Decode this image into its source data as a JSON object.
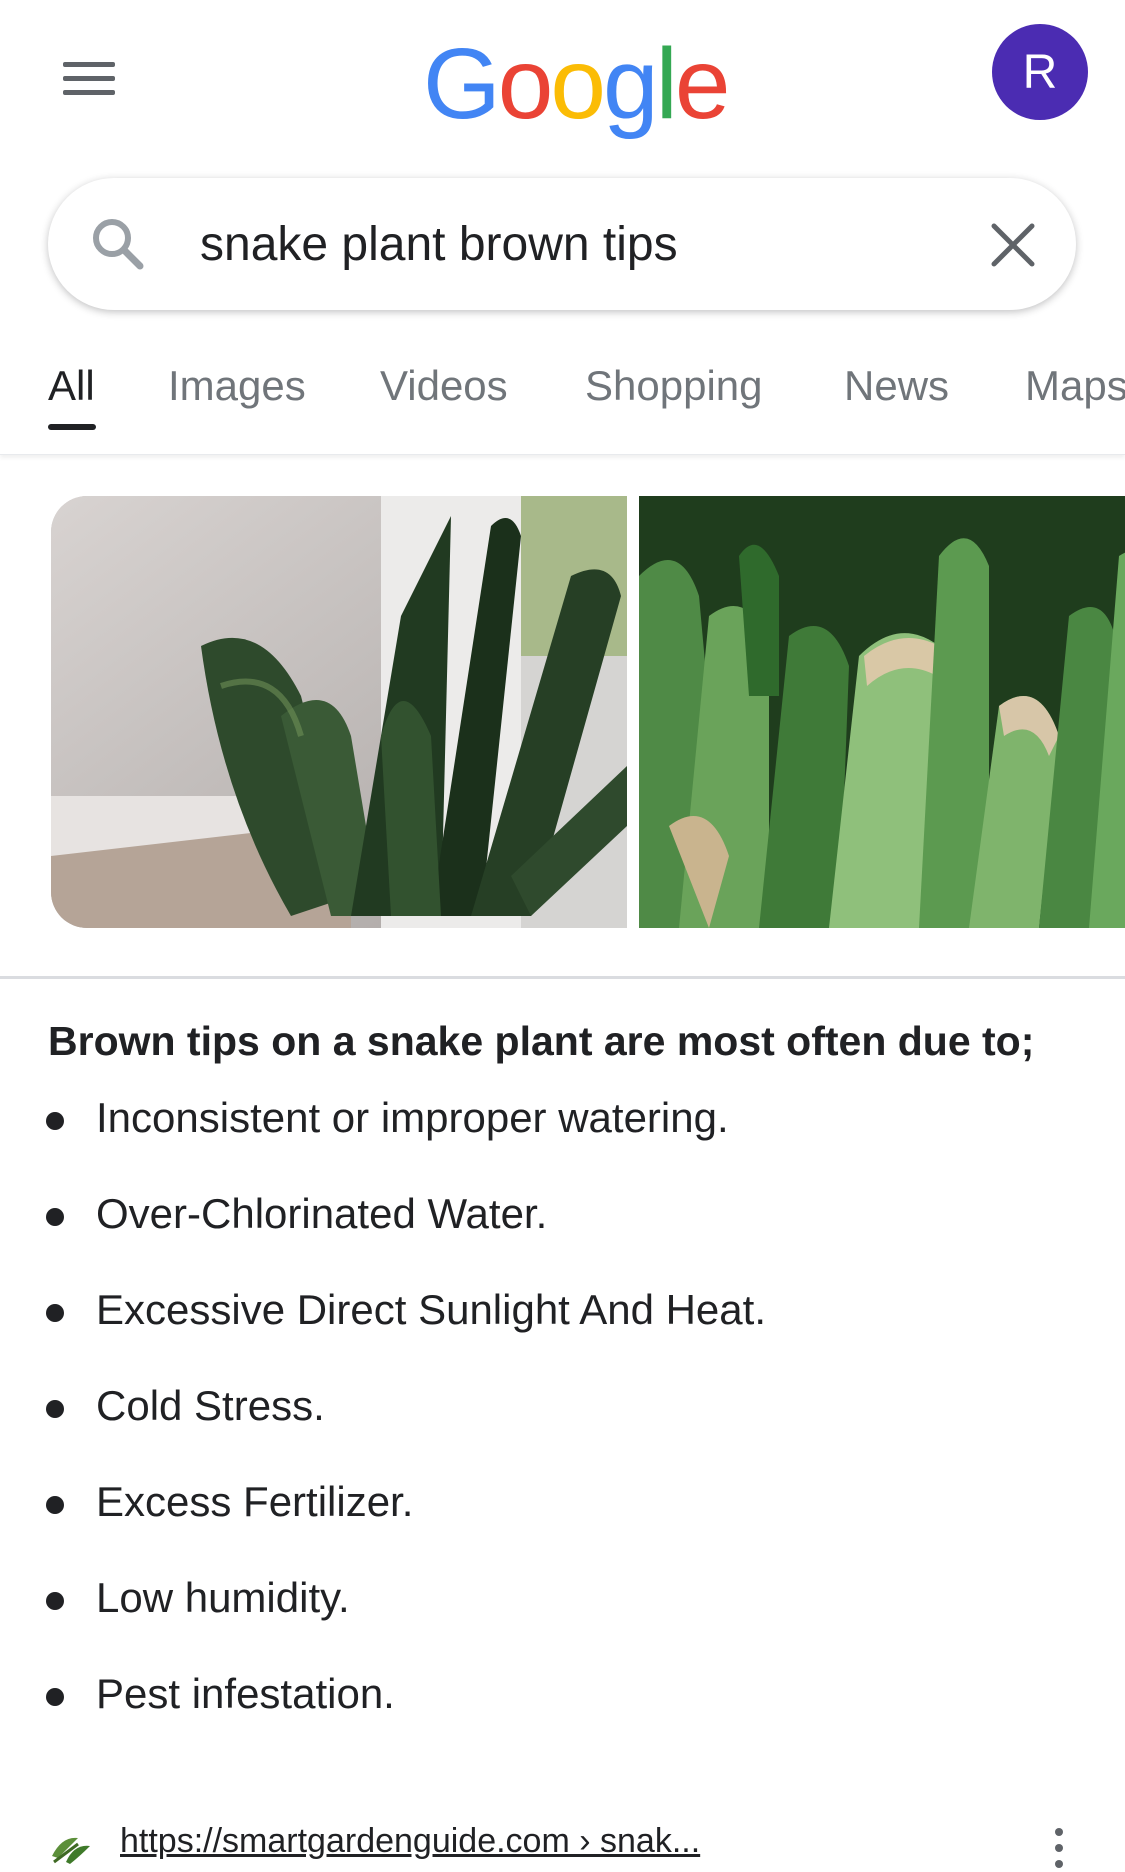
{
  "header": {
    "logo_letters": [
      {
        "char": "G",
        "color": "#4285F4"
      },
      {
        "char": "o",
        "color": "#EA4335"
      },
      {
        "char": "o",
        "color": "#FBBC05"
      },
      {
        "char": "g",
        "color": "#4285F4"
      },
      {
        "char": "l",
        "color": "#34A853"
      },
      {
        "char": "e",
        "color": "#EA4335"
      }
    ],
    "avatar_initial": "R",
    "avatar_color": "#4B2CB2",
    "menu_icon": "hamburger-menu-icon"
  },
  "search": {
    "query": "snake plant brown tips",
    "search_icon": "search-icon",
    "clear_icon": "close-icon"
  },
  "tabs": [
    {
      "label": "All",
      "active": true
    },
    {
      "label": "Images",
      "active": false
    },
    {
      "label": "Videos",
      "active": false
    },
    {
      "label": "Shopping",
      "active": false
    },
    {
      "label": "News",
      "active": false
    },
    {
      "label": "Maps",
      "active": false
    }
  ],
  "image_results": [
    {
      "subject": "snake-plant-dark-leaves"
    },
    {
      "subject": "snake-plant-brown-tips-closeup"
    }
  ],
  "answer": {
    "title": "Brown tips on a snake plant are most often due to;",
    "items": [
      "Inconsistent or improper watering.",
      "Over-Chlorinated Water.",
      "Excessive Direct Sunlight And Heat.",
      "Cold Stress.",
      "Excess Fertilizer.",
      "Low humidity.",
      "Pest infestation."
    ]
  },
  "source": {
    "url": "https://smartgardenguide.com › snak...",
    "favicon": "leaf-icon",
    "more_icon": "more-vert-icon"
  }
}
